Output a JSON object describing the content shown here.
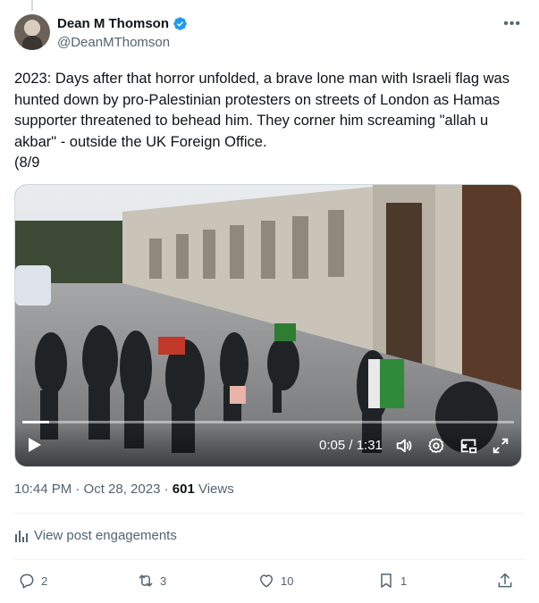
{
  "author": {
    "display_name": "Dean M Thomson",
    "handle": "@DeanMThomson"
  },
  "post": {
    "text": "2023: Days after that horror unfolded, a brave lone man with Israeli flag was hunted down by pro-Palestinian protesters on streets of London as Hamas supporter threatened to behead him. They corner him screaming \"allah u akbar\" - outside the UK Foreign Office.\n(8/9",
    "timestamp": "10:44 PM · Oct 28, 2023 · ",
    "views_count": "601",
    "views_label": " Views"
  },
  "video": {
    "time": "0:05 / 1:31",
    "progress": 0.055
  },
  "engagements_label": "View post engagements",
  "actions": {
    "replies": "2",
    "reposts": "3",
    "likes": "10",
    "bookmarks": "1"
  },
  "colors": {
    "accent": "#1d9bf0",
    "muted": "#536471",
    "text": "#0f1419"
  },
  "icons": {
    "more": "more-horizontal-icon",
    "verified": "verified-badge-icon",
    "play": "play-icon",
    "volume": "volume-icon",
    "settings": "settings-icon",
    "pip": "picture-in-picture-icon",
    "fullscreen": "fullscreen-icon",
    "analytics": "analytics-icon",
    "reply": "reply-icon",
    "repost": "repost-icon",
    "like": "heart-icon",
    "bookmark": "bookmark-icon",
    "share": "share-icon"
  }
}
